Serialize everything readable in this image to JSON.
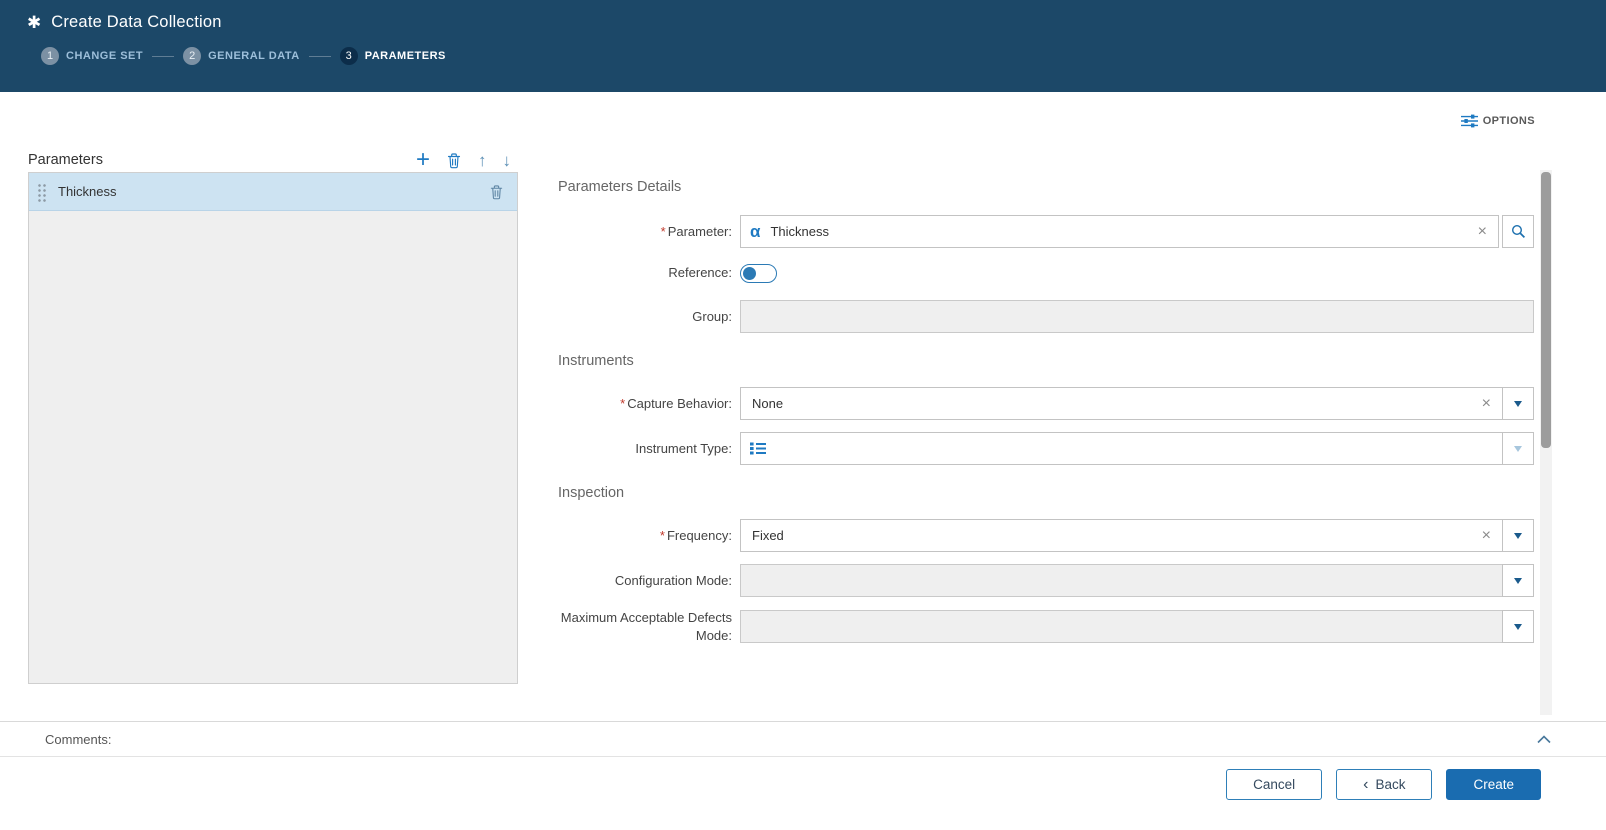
{
  "header": {
    "title": "Create Data Collection",
    "steps": [
      {
        "number": "1",
        "label": "CHANGE SET"
      },
      {
        "number": "2",
        "label": "GENERAL DATA"
      },
      {
        "number": "3",
        "label": "PARAMETERS"
      }
    ]
  },
  "toolbar": {
    "options_label": "OPTIONS"
  },
  "left_panel": {
    "title": "Parameters",
    "items": [
      {
        "label": "Thickness",
        "selected": true
      }
    ]
  },
  "details": {
    "required_marker": "*",
    "sections": [
      "Parameters Details",
      "Instruments",
      "Inspection"
    ],
    "fields": {
      "parameter": {
        "label": "Parameter:",
        "value": "Thickness",
        "required": true
      },
      "reference": {
        "label": "Reference:",
        "state": "off"
      },
      "group": {
        "label": "Group:",
        "value": ""
      },
      "capture_behavior": {
        "label": "Capture Behavior:",
        "value": "None",
        "required": true
      },
      "instrument_type": {
        "label": "Instrument Type:",
        "value": ""
      },
      "frequency": {
        "label": "Frequency:",
        "value": "Fixed",
        "required": true
      },
      "configuration_mode": {
        "label": "Configuration Mode:",
        "value": ""
      },
      "max_defects_mode": {
        "label": "Maximum Acceptable Defects Mode:",
        "value": ""
      }
    }
  },
  "comments": {
    "label": "Comments:"
  },
  "footer": {
    "cancel": "Cancel",
    "back": "Back",
    "create": "Create"
  },
  "icons": {
    "app": "✱",
    "plus": "+",
    "arrow_up": "↑",
    "arrow_down": "↓",
    "clear": "×",
    "alpha": "α",
    "back_chevron": "‹"
  },
  "colors": {
    "header_bg": "#1c4868",
    "accent": "#1f7ac2",
    "primary_button": "#1a6cb0",
    "selected_row": "#cde3f2",
    "required": "#c0392b"
  }
}
